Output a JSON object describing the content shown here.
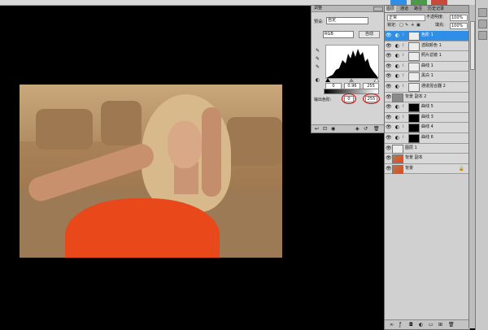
{
  "levels_panel": {
    "tab_label": "调整",
    "preset_label": "预设:",
    "preset_value": "自定",
    "channel_value": "RGB",
    "auto_button": "自动",
    "input_black": "0",
    "input_gamma": "0.96",
    "input_white": "255",
    "output_label": "输出色阶:",
    "output_black": "0",
    "output_white": "255"
  },
  "layers_panel": {
    "tabs": [
      "图层",
      "通道",
      "路径",
      "历史记录"
    ],
    "blend_mode": "正常",
    "opacity_label": "不透明度:",
    "opacity_value": "100%",
    "lock_label": "锁定:",
    "fill_label": "填充:",
    "fill_value": "100%",
    "layers": [
      {
        "name": "色阶 1",
        "thumb": "light",
        "adjustment": true,
        "selected": true
      },
      {
        "name": "选取颜色 1",
        "thumb": "light",
        "adjustment": true,
        "selected": false
      },
      {
        "name": "照片滤镜 1",
        "thumb": "light",
        "adjustment": true,
        "selected": false
      },
      {
        "name": "曲线 1",
        "thumb": "light",
        "adjustment": true,
        "selected": false
      },
      {
        "name": "黑白 1",
        "thumb": "light",
        "adjustment": true,
        "selected": false
      },
      {
        "name": "通道混合器 2",
        "thumb": "light",
        "adjustment": true,
        "selected": false
      },
      {
        "name": "背景 副本 2",
        "thumb": "gray",
        "adjustment": false,
        "selected": false
      },
      {
        "name": "曲线 5",
        "thumb": "black",
        "adjustment": true,
        "selected": false
      },
      {
        "name": "曲线 3",
        "thumb": "black",
        "adjustment": true,
        "selected": false
      },
      {
        "name": "曲线 4",
        "thumb": "black",
        "adjustment": true,
        "selected": false
      },
      {
        "name": "曲线 6",
        "thumb": "black",
        "adjustment": true,
        "selected": false
      },
      {
        "name": "图层 1",
        "thumb": "light",
        "adjustment": false,
        "selected": false
      },
      {
        "name": "背景 副本",
        "thumb": "photo",
        "adjustment": false,
        "selected": false
      },
      {
        "name": "背景",
        "thumb": "photo",
        "adjustment": false,
        "selected": false
      }
    ]
  },
  "colors": {
    "selected_layer": "#2f8fe6",
    "annotation_red": "#e00000",
    "dress_orange": "#e8481a"
  }
}
